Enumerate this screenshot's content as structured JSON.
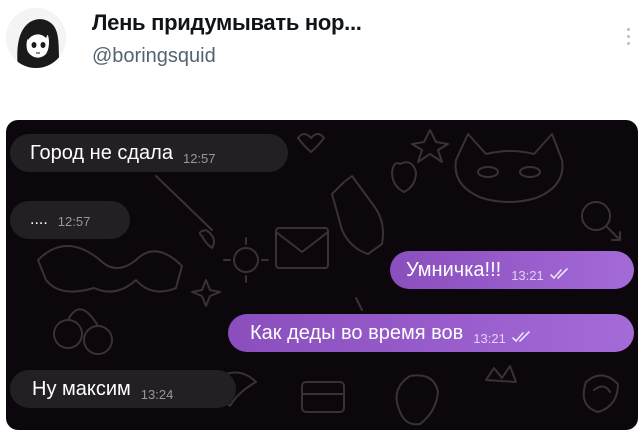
{
  "tweet": {
    "display_name": "Лень придумывать нор...",
    "handle": "@boringsquid"
  },
  "messages": [
    {
      "text": "Город не сдала",
      "time": "12:57",
      "direction": "incoming"
    },
    {
      "text": "....",
      "time": "12:57",
      "direction": "incoming"
    },
    {
      "text": "Умничка!!!",
      "time": "13:21",
      "direction": "outgoing",
      "status": "read-double-check"
    },
    {
      "text": "Как деды во время вов",
      "time": "13:21",
      "direction": "outgoing",
      "status": "read-double-check"
    },
    {
      "text": "Ну максим",
      "time": "13:24",
      "direction": "incoming"
    }
  ],
  "colors": {
    "chat_background": "#0b070d",
    "incoming_bubble": "#232024",
    "outgoing_bubble": "#9a5fd0",
    "doodle_stroke": "#3a3138"
  },
  "icons": [
    "avatar-anime-girl",
    "more-vertical-icon",
    "double-check-icon"
  ]
}
